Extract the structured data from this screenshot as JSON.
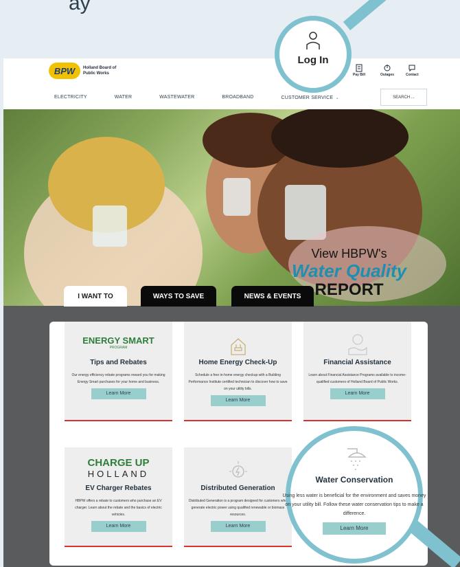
{
  "caption": "ay",
  "header": {
    "logo_badge": "BPW",
    "logo_text": "Holland Board of Public Works",
    "login_label": "Log In",
    "utilities": [
      {
        "label": "Pay Bill",
        "icon": "bill-icon"
      },
      {
        "label": "Outages",
        "icon": "outage-icon"
      },
      {
        "label": "Contact",
        "icon": "chat-icon"
      }
    ]
  },
  "nav": {
    "items": [
      "ELECTRICITY",
      "WATER",
      "WASTEWATER",
      "BROADBAND",
      "CUSTOMER SERVICE"
    ],
    "search_label": "SEARCH ..."
  },
  "hero": {
    "line1": "View HBPW's",
    "line2": "Water Quality",
    "line3": "REPORT"
  },
  "tabs": [
    "I WANT TO",
    "WAYS TO SAVE",
    "NEWS & EVENTS"
  ],
  "cards": [
    {
      "brand": "ENERGY SMART",
      "brand_sub": "PROGRAM",
      "title": "Tips and Rebates",
      "desc": "Our energy efficiency rebate programs reward you for making Energy Smart purchases for your home and business.",
      "button": "Learn More"
    },
    {
      "title": "Home Energy Check-Up",
      "desc": "Schedule a free in-home energy checkup with a Building Performance Institute certified technician to discover how to save on your utility bills.",
      "button": "Learn More"
    },
    {
      "title": "Financial Assistance",
      "desc": "Learn about Financial Assistance Programs available to income-qualified customers of Holland Board of Public Works.",
      "button": "Learn More"
    },
    {
      "brand": "CHARGE UP",
      "brand_sub": "HOLLAND",
      "title": "EV Charger Rebates",
      "desc": "HBPW offers a rebate to customers who purchase an EV charger. Learn about the rebate and the basics of electric vehicles.",
      "button": "Learn More"
    },
    {
      "title": "Distributed Generation",
      "desc": "Distributed Generation is a program designed for customers who generate electric power using qualified renewable or biomass resources.",
      "button": "Learn More"
    },
    {
      "title": "Water Conservation",
      "desc": "Using less water is beneficial for the environment and saves money on your utility bill. Follow these water conservation tips to make a difference.",
      "button": "Learn More"
    }
  ],
  "colors": {
    "accent": "#98cfcd",
    "magnifier": "#7fc1cf",
    "card_rule": "#d6332c",
    "report_blue": "#1e8fb0"
  }
}
